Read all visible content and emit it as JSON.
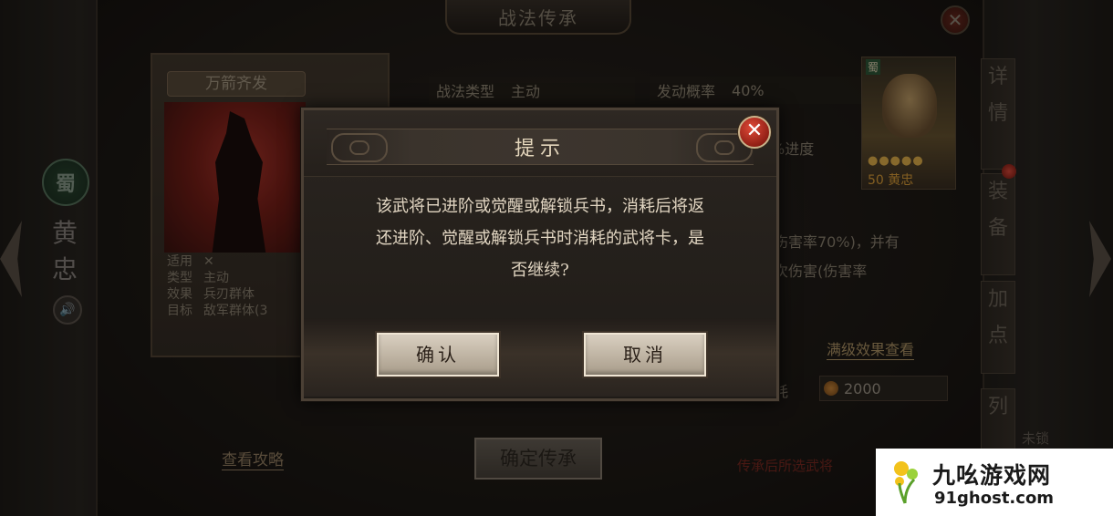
{
  "background": {
    "window_title": "战法传承",
    "hero": {
      "faction": "蜀",
      "name_vertical": "黄忠"
    },
    "skill_card": {
      "name": "万箭齐发",
      "props": [
        {
          "label": "适用",
          "value": ""
        },
        {
          "label": "类型",
          "value": "主动"
        },
        {
          "label": "效果",
          "value": "兵刃群体"
        },
        {
          "label": "目标",
          "value": "敌军群体(3"
        }
      ]
    },
    "info": {
      "type_label": "战法类型",
      "type_value": "主动",
      "prob_label": "发动概率",
      "prob_value": "40%",
      "progress_fragment": "%进度",
      "desc_fragment_1": "伤害率70%)，并有",
      "desc_fragment_2": "次伤害(伤害率",
      "full_effect_link": "满级效果查看",
      "cost_fragment": "耗",
      "cost_value": "2000"
    },
    "guide_link": "查看攻略",
    "confirm_inherit_button": "确定传承",
    "inherit_note": "传承后所选武将",
    "portrait": {
      "faction": "蜀",
      "stars": "●●●●●",
      "level_name": "50 黄忠"
    },
    "side_tabs": [
      "详情",
      "装备",
      "加点",
      "列"
    ],
    "unlock_fragment": "未锁"
  },
  "dialog": {
    "title": "提示",
    "message": "该武将已进阶或觉醒或解锁兵书，消耗后将返\n还进阶、觉醒或解锁兵书时消耗的武将卡，是\n否继续?",
    "confirm_label": "确认",
    "cancel_label": "取消",
    "close_symbol": "✕"
  },
  "watermark": {
    "cn": "九吆游戏网",
    "en": "91ghost.com"
  },
  "colors": {
    "dialog_bg": "#2a2520",
    "button_face": "#d9cfc0",
    "close_red": "#c8301f",
    "accent_gold": "#b59a6a"
  }
}
